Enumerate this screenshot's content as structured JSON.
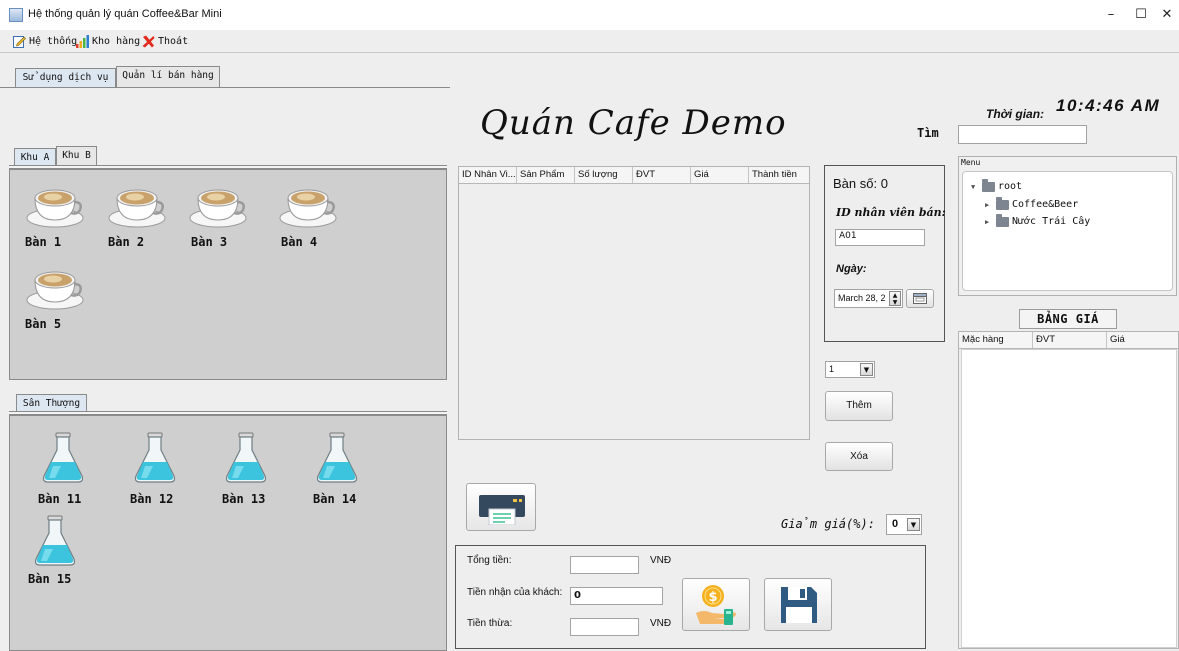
{
  "window": {
    "title": "Hệ thống quản lý quán Coffee&Bar Mini",
    "controls": {
      "minimize": "–",
      "maximize": "☐",
      "close": "✕"
    }
  },
  "menubar": {
    "items": [
      {
        "label": "Hệ thống",
        "icon": "edit-icon"
      },
      {
        "label": "Kho hàng",
        "icon": "bar-chart-icon"
      },
      {
        "label": "Thoát",
        "icon": "red-x-icon"
      }
    ]
  },
  "main_tabs": [
    {
      "label": "Sử dụng dịch vụ",
      "active": true
    },
    {
      "label": "Quản lí bán hàng",
      "active": false
    }
  ],
  "area_tabs": [
    {
      "label": "Khu A",
      "active": true
    },
    {
      "label": "Khu B",
      "active": false
    }
  ],
  "area_a_tables": [
    "Bàn 1",
    "Bàn 2",
    "Bàn 3",
    "Bàn 4",
    "Bàn 5"
  ],
  "rooftop_tab": {
    "label": "Sân Thượng"
  },
  "rooftop_tables": [
    "Bàn 11",
    "Bàn 12",
    "Bàn 13",
    "Bàn 14",
    "Bàn 15"
  ],
  "header": {
    "cafe_title": "Quán Cafe Demo",
    "search_label": "Tìm",
    "search_value": "",
    "time_label": "Thời gian:",
    "time_value": "10:4:46 AM"
  },
  "order_table": {
    "columns": [
      "ID Nhân Vi...",
      "Sản Phẩm",
      "Số lượng",
      "ĐVT",
      "Giá",
      "Thành tiền"
    ],
    "rows": []
  },
  "table_info": {
    "table_number": "Bàn số: 0",
    "staff_id_label": "ID nhân viên bán:",
    "staff_id_value": "A01",
    "date_label": "Ngày:",
    "date_value": "March 28, 2"
  },
  "quantity_select": {
    "value": "1"
  },
  "buttons": {
    "add": "Thêm",
    "delete": "Xóa"
  },
  "discount": {
    "label": "Giảm giá(%):",
    "value": "0"
  },
  "totals": {
    "total_label": "Tổng tiền:",
    "total_value": "",
    "total_unit": "VNĐ",
    "received_label": "Tiền nhận của khách:",
    "received_value": "0",
    "change_label": "Tiền thừa:",
    "change_value": "",
    "change_unit": "VNĐ"
  },
  "menu_panel": {
    "title": "Menu",
    "tree": [
      {
        "label": "root",
        "expanded": true,
        "level": 0
      },
      {
        "label": "Coffee&Beer",
        "expanded": false,
        "level": 1
      },
      {
        "label": "Nước Trái Cây",
        "expanded": false,
        "level": 1
      }
    ]
  },
  "price_board": {
    "title": "BẢNG GIÁ",
    "columns": [
      "Mặc hàng",
      "ĐVT",
      "Giá"
    ],
    "rows": []
  },
  "colors": {
    "area_bg": "#cfcfcf",
    "window_bg": "#eeeeee",
    "flask_liquid": "#3cc3dd",
    "coin": "#f6b11f"
  }
}
